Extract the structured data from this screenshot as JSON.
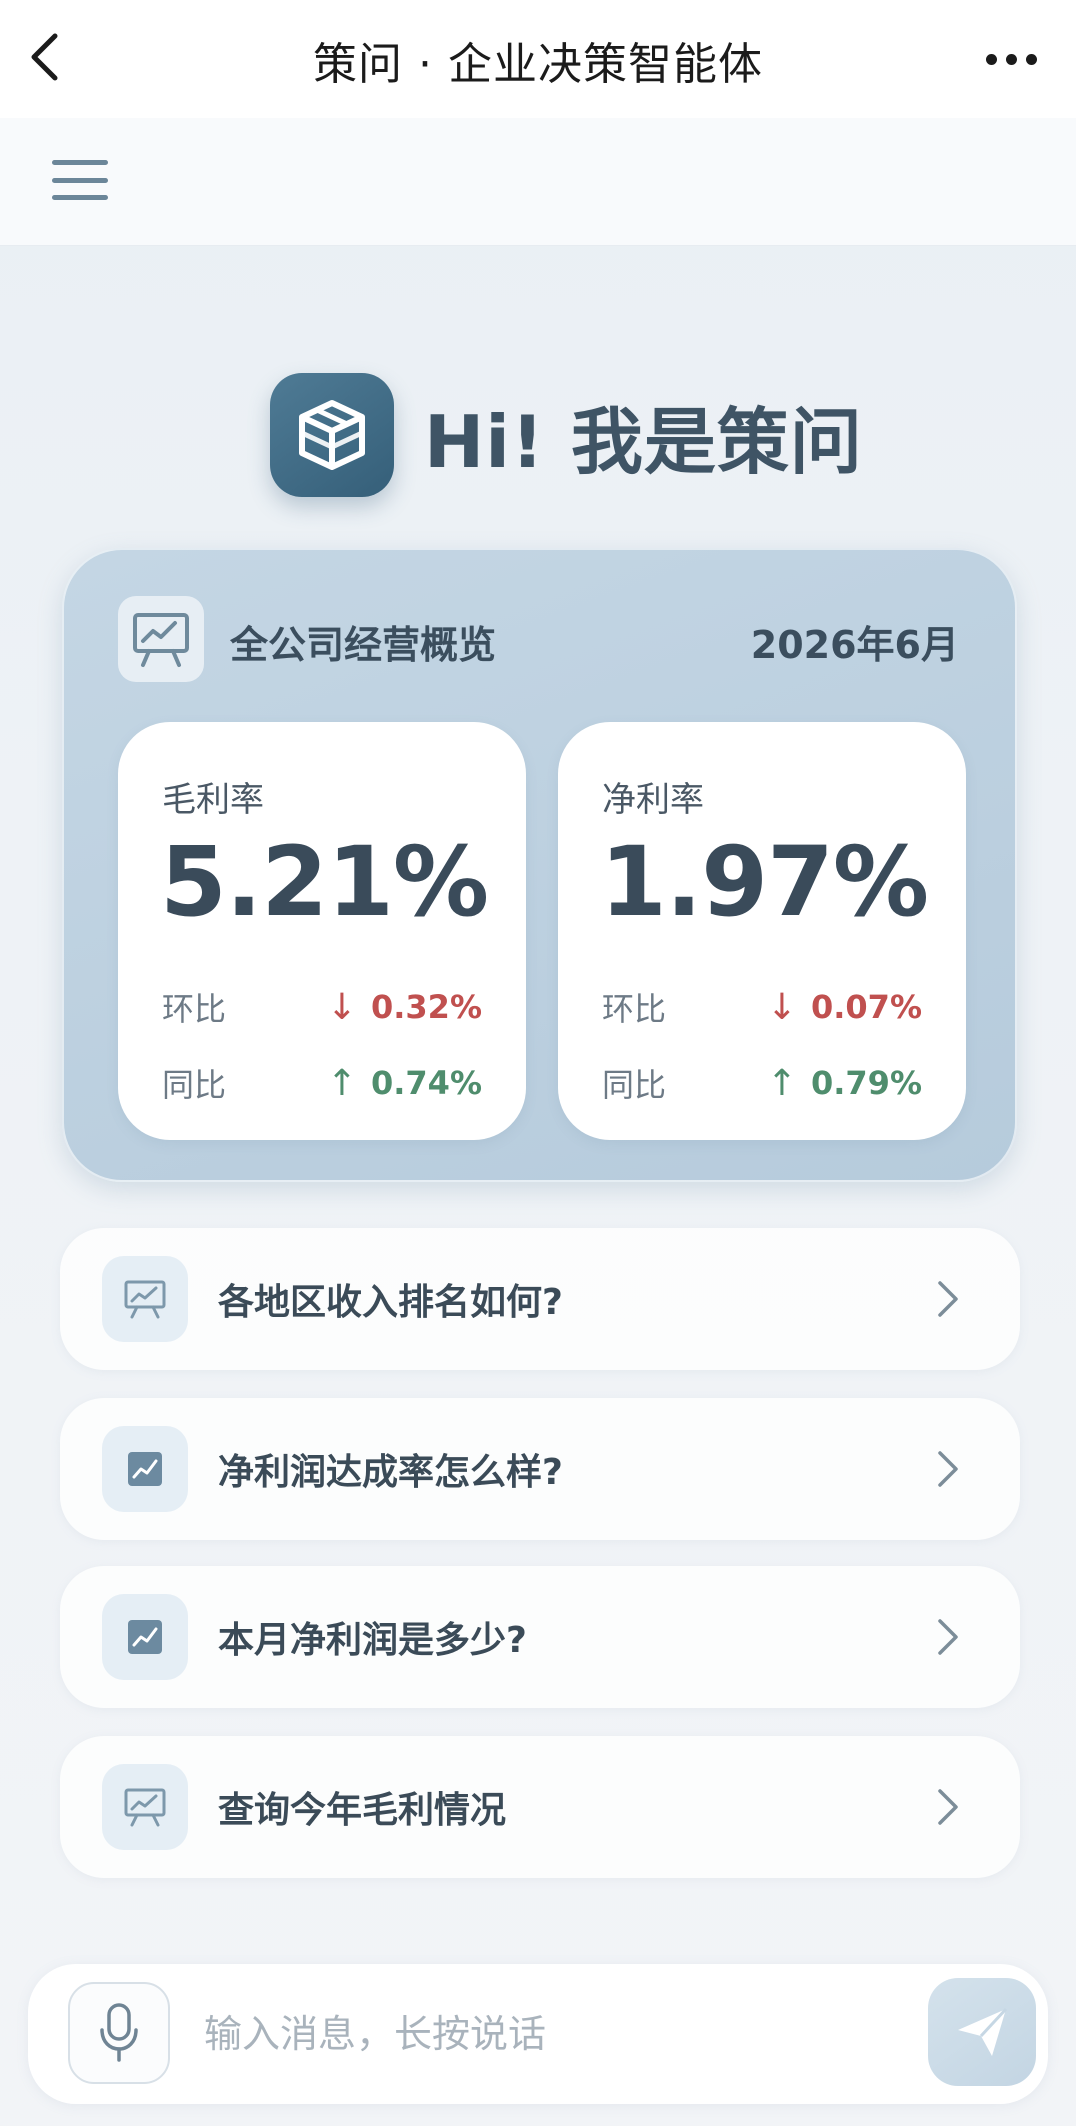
{
  "nav": {
    "title": "策问 · 企业决策智能体"
  },
  "greeting": {
    "text": "Hi! 我是策问"
  },
  "overview": {
    "title": "全公司经营概览",
    "date": "2026年6月",
    "metrics": [
      {
        "label": "毛利率",
        "value": "5.21%",
        "mom_label": "环比",
        "mom_arrow": "↓",
        "mom_value": "0.32%",
        "mom_direction": "down",
        "yoy_label": "同比",
        "yoy_arrow": "↑",
        "yoy_value": "0.74%",
        "yoy_direction": "up"
      },
      {
        "label": "净利率",
        "value": "1.97%",
        "mom_label": "环比",
        "mom_arrow": "↓",
        "mom_value": "0.07%",
        "mom_direction": "down",
        "yoy_label": "同比",
        "yoy_arrow": "↑",
        "yoy_value": "0.79%",
        "yoy_direction": "up"
      }
    ]
  },
  "suggestions": [
    {
      "text": "各地区收入排名如何?",
      "icon": "presentation-chart-icon"
    },
    {
      "text": "净利润达成率怎么样?",
      "icon": "line-chart-icon"
    },
    {
      "text": "本月净利润是多少?",
      "icon": "line-chart-icon"
    },
    {
      "text": "查询今年毛利情况",
      "icon": "presentation-chart-icon"
    }
  ],
  "input": {
    "placeholder": "输入消息，长按说话"
  },
  "colors": {
    "accent": "#3f6f8c",
    "down": "#c0504f",
    "up": "#4f8d6d",
    "card_bg": "#bacfdf"
  }
}
